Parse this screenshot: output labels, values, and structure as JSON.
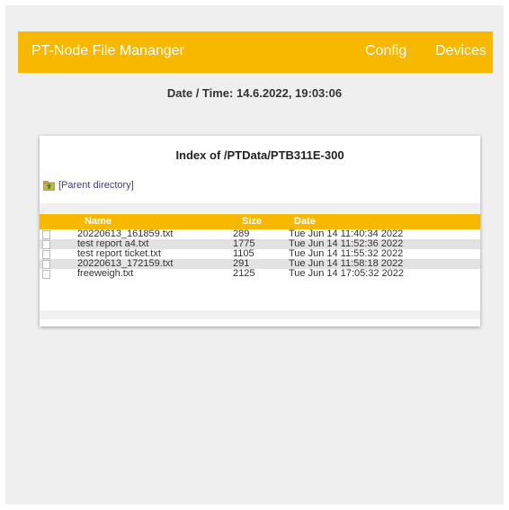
{
  "header": {
    "title": "PT-Node File Mananger",
    "nav": {
      "config": "Config",
      "devices": "Devices"
    }
  },
  "datetime": "Date / Time: 14.6.2022, 19:03:06",
  "index": {
    "title": "Index of /PTData/PTB311E-300",
    "parent_link": "[Parent directory]",
    "columns": {
      "name": "Name",
      "size": "Size",
      "date": "Date"
    },
    "files": [
      {
        "name": "20220613_161859.txt",
        "size": "289",
        "date": "Tue Jun 14 11:40:34 2022"
      },
      {
        "name": "test report a4.txt",
        "size": "1775",
        "date": "Tue Jun 14 11:52:36 2022"
      },
      {
        "name": "test report ticket.txt",
        "size": "1105",
        "date": "Tue Jun 14 11:55:32 2022"
      },
      {
        "name": "20220613_172159.txt",
        "size": "291",
        "date": "Tue Jun 14 11:58:18 2022"
      },
      {
        "name": "freeweigh.txt",
        "size": "2125",
        "date": "Tue Jun 14 17:05:32 2022"
      }
    ]
  },
  "colors": {
    "accent": "#f8b800",
    "background": "#efefef",
    "link": "#4a3a8c"
  },
  "icons": {
    "parent": "folder-up-icon",
    "file": "file-icon"
  }
}
